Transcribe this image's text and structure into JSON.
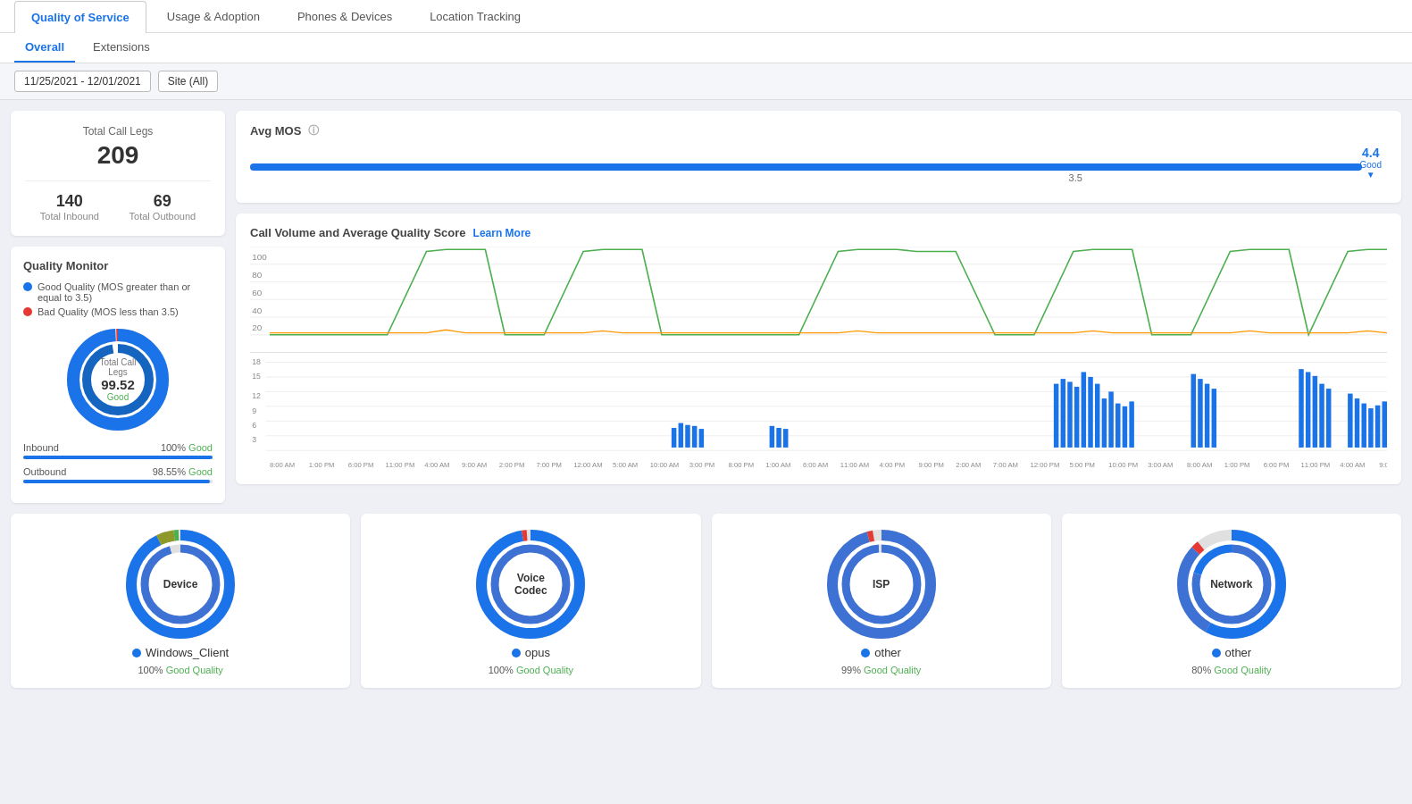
{
  "topNav": {
    "tabs": [
      {
        "id": "quality",
        "label": "Quality of Service",
        "active": true
      },
      {
        "id": "usage",
        "label": "Usage & Adoption",
        "active": false
      },
      {
        "id": "phones",
        "label": "Phones & Devices",
        "active": false
      },
      {
        "id": "location",
        "label": "Location Tracking",
        "active": false
      }
    ]
  },
  "subNav": {
    "tabs": [
      {
        "id": "overall",
        "label": "Overall",
        "active": true
      },
      {
        "id": "extensions",
        "label": "Extensions",
        "active": false
      }
    ]
  },
  "filters": {
    "dateRange": "11/25/2021 - 12/01/2021",
    "site": "Site (All)"
  },
  "stats": {
    "totalCallLegsLabel": "Total Call Legs",
    "totalCallLegs": "209",
    "totalInboundLabel": "Total Inbound",
    "totalInbound": "140",
    "totalOutboundLabel": "Total Outbound",
    "totalOutbound": "69"
  },
  "qualityMonitor": {
    "title": "Quality Monitor",
    "goodLegend": "Good Quality (MOS greater than or equal to 3.5)",
    "badLegend": "Bad Quality (MOS less than 3.5)",
    "donutLabel": "Total Call Legs",
    "donutPct": "99.52",
    "donutQuality": "Good",
    "inboundLabel": "Inbound",
    "inboundPct": "100%",
    "inboundQualityLabel": "Good",
    "inboundBarWidth": 100,
    "outboundLabel": "Outbound",
    "outboundPct": "98.55%",
    "outboundQualityLabel": "Good",
    "outboundBarWidth": 98.55
  },
  "avgMos": {
    "title": "Avg MOS",
    "value": "4.4",
    "valueLabel": "Good",
    "midpoint": "3.5"
  },
  "callVolume": {
    "title": "Call Volume and Average Quality Score",
    "learnMore": "Learn More"
  },
  "bottomCharts": [
    {
      "id": "device",
      "centerLabel": "Device",
      "legendItem": "Windows_Client",
      "legendPct": "100%",
      "legendQuality": "Good Quality"
    },
    {
      "id": "voice-codec",
      "centerLabel": "Voice\nCodec",
      "legendItem": "opus",
      "legendPct": "100%",
      "legendQuality": "Good Quality"
    },
    {
      "id": "isp",
      "centerLabel": "ISP",
      "legendItem": "other",
      "legendPct": "99%",
      "legendQuality": "Good Quality"
    },
    {
      "id": "network",
      "centerLabel": "Network",
      "legendItem": "other",
      "legendPct": "80%",
      "legendQuality": "Good Quality"
    }
  ],
  "colors": {
    "blue": "#1a73e8",
    "lightBlue": "#4db6f5",
    "darkBlue": "#1565c0",
    "red": "#e53935",
    "olive": "#8d9a2a",
    "green": "#4caf50",
    "gray": "#e0e0e0",
    "bgBlue": "#3d72d4",
    "accent": "#2196f3"
  }
}
